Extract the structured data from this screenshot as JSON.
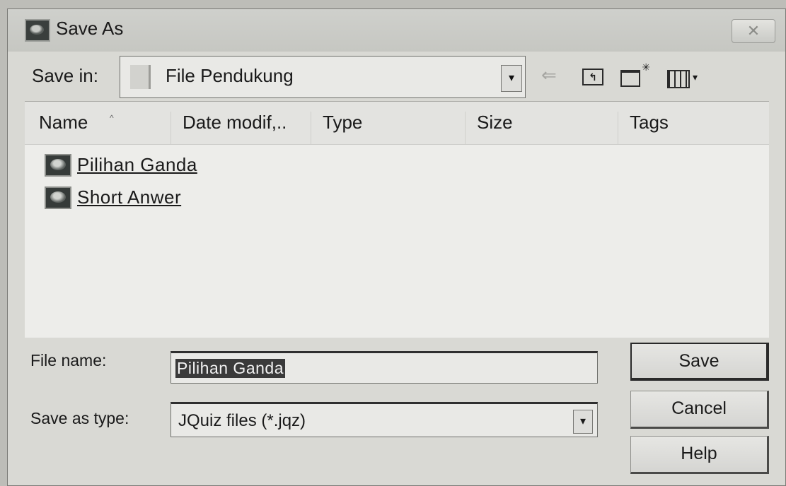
{
  "window": {
    "title": "Save As",
    "close_glyph": "✕",
    "icon": "app-icon"
  },
  "toolbar": {
    "save_in_label": "Save in:",
    "save_in_value": "File Pendukung",
    "dropdown_glyph": "▾",
    "back_glyph": "⇐",
    "up_glyph": "↰",
    "view_menu_glyph": "▾"
  },
  "filelist": {
    "columns": [
      "Name",
      "Date modif,..",
      "Type",
      "Size",
      "Tags"
    ],
    "sort_glyph": "^",
    "items": [
      {
        "name": "Pilihan Ganda"
      },
      {
        "name": "Short Anwer"
      }
    ]
  },
  "form": {
    "file_name_label": "File name:",
    "file_name_value": "Pilihan Ganda",
    "type_label": "Save as type:",
    "type_value": "JQuiz files (*.jqz)"
  },
  "buttons": {
    "save": "Save",
    "cancel": "Cancel",
    "help": "Help"
  }
}
